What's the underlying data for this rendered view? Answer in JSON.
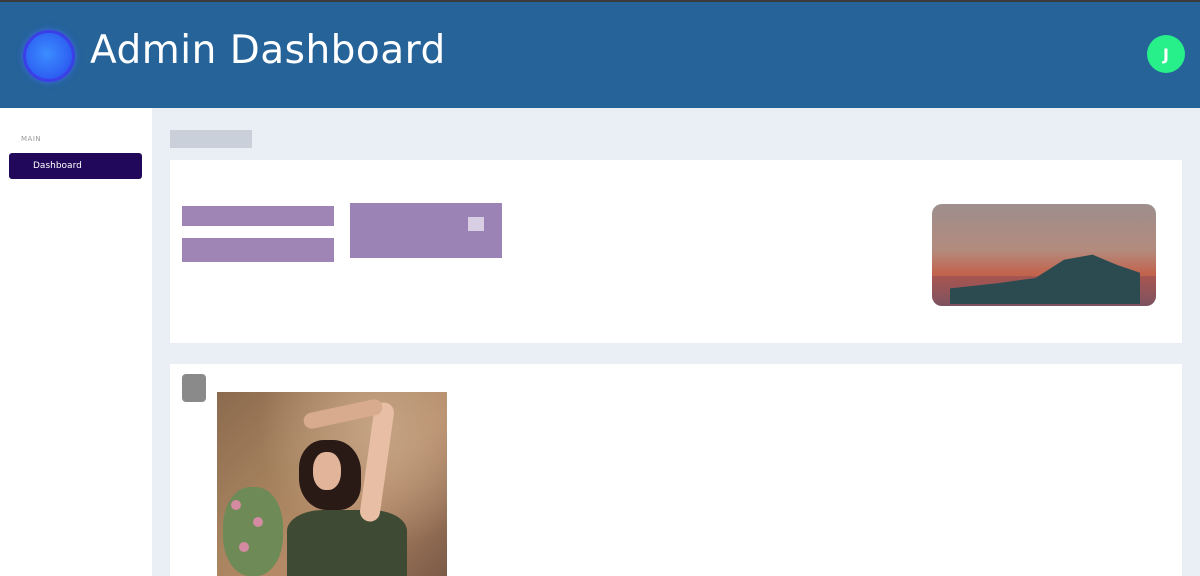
{
  "header": {
    "title": "Admin Dashboard",
    "user_initial": "J"
  },
  "sidebar": {
    "section_main": "MAIN",
    "section_secondary": "",
    "items": [
      {
        "label": "Dashboard",
        "active": true
      },
      {
        "label": "",
        "active": false
      },
      {
        "label": "",
        "active": false
      },
      {
        "label": "",
        "active": false
      },
      {
        "label": "",
        "active": false
      },
      {
        "label": "",
        "active": false
      },
      {
        "label": "",
        "active": false
      },
      {
        "label": "",
        "active": false
      }
    ]
  },
  "main": {
    "page_title": "",
    "card1": {
      "heading": "",
      "pill_1": "",
      "pill_2": "",
      "pill_big": "",
      "right_text": "",
      "footer": "",
      "thumb_label": ""
    },
    "post": {
      "author": "",
      "text": ""
    }
  },
  "colors": {
    "header_bg": "#256399",
    "active_nav": "#22085a",
    "avatar": "#27f08a",
    "accent_purple": "#9e85b5"
  },
  "icons": {
    "logo": "circle-logo-icon",
    "pill_icon": "square-icon"
  }
}
